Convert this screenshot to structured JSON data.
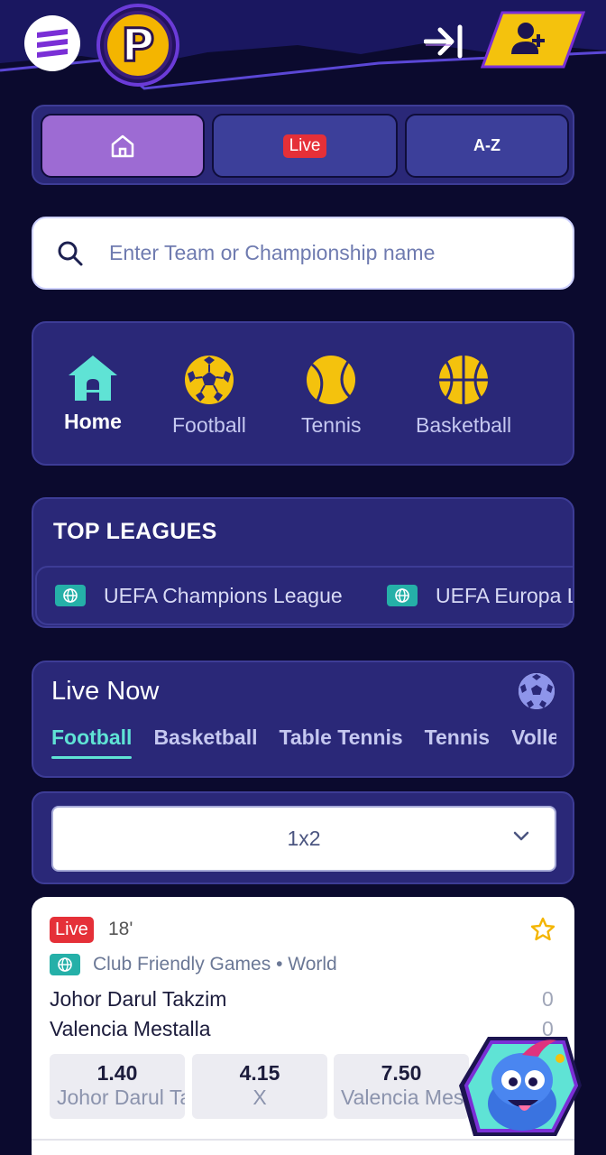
{
  "header": {
    "menu_icon": "hamburger-menu-icon",
    "logo_letter": "P",
    "login_icon": "login-arrow-icon",
    "register_icon": "add-user-icon"
  },
  "nav_tabs": {
    "home_icon": "home-icon",
    "live_label": "Live",
    "az_label": "A-Z"
  },
  "search": {
    "placeholder": "Enter Team or Championship name",
    "value": ""
  },
  "sports": [
    {
      "label": "Home",
      "icon": "home-icon",
      "active": true
    },
    {
      "label": "Football",
      "icon": "football-icon"
    },
    {
      "label": "Tennis",
      "icon": "tennis-ball-icon"
    },
    {
      "label": "Basketball",
      "icon": "basketball-icon"
    }
  ],
  "top_leagues": {
    "title": "TOP LEAGUES",
    "items": [
      {
        "label": "UEFA Champions League",
        "icon": "globe-icon"
      },
      {
        "label": "UEFA Europa League",
        "icon": "globe-icon"
      }
    ]
  },
  "live_now": {
    "title": "Live Now",
    "tabs": [
      "Football",
      "Basketball",
      "Table Tennis",
      "Tennis",
      "Volleyball"
    ],
    "active_tab": "Football"
  },
  "market": {
    "selected": "1x2"
  },
  "match": {
    "live_label": "Live",
    "minute": "18'",
    "competition": "Club Friendly Games • World",
    "team_home": "Johor Darul Takzim",
    "team_away": "Valencia Mestalla",
    "score_home": "0",
    "score_away": "0",
    "odds": [
      {
        "value": "1.40",
        "label": "Johor Darul Takzim"
      },
      {
        "value": "4.15",
        "label": "X"
      },
      {
        "value": "7.50",
        "label": "Valencia Mestalla"
      }
    ]
  },
  "colors": {
    "background": "#0b0a2e",
    "panel": "#2a2878",
    "accent_teal": "#5fe3d5",
    "live_red": "#e53038",
    "home_tab": "#9d6bd3",
    "sport_icon": "#f4c20d"
  }
}
